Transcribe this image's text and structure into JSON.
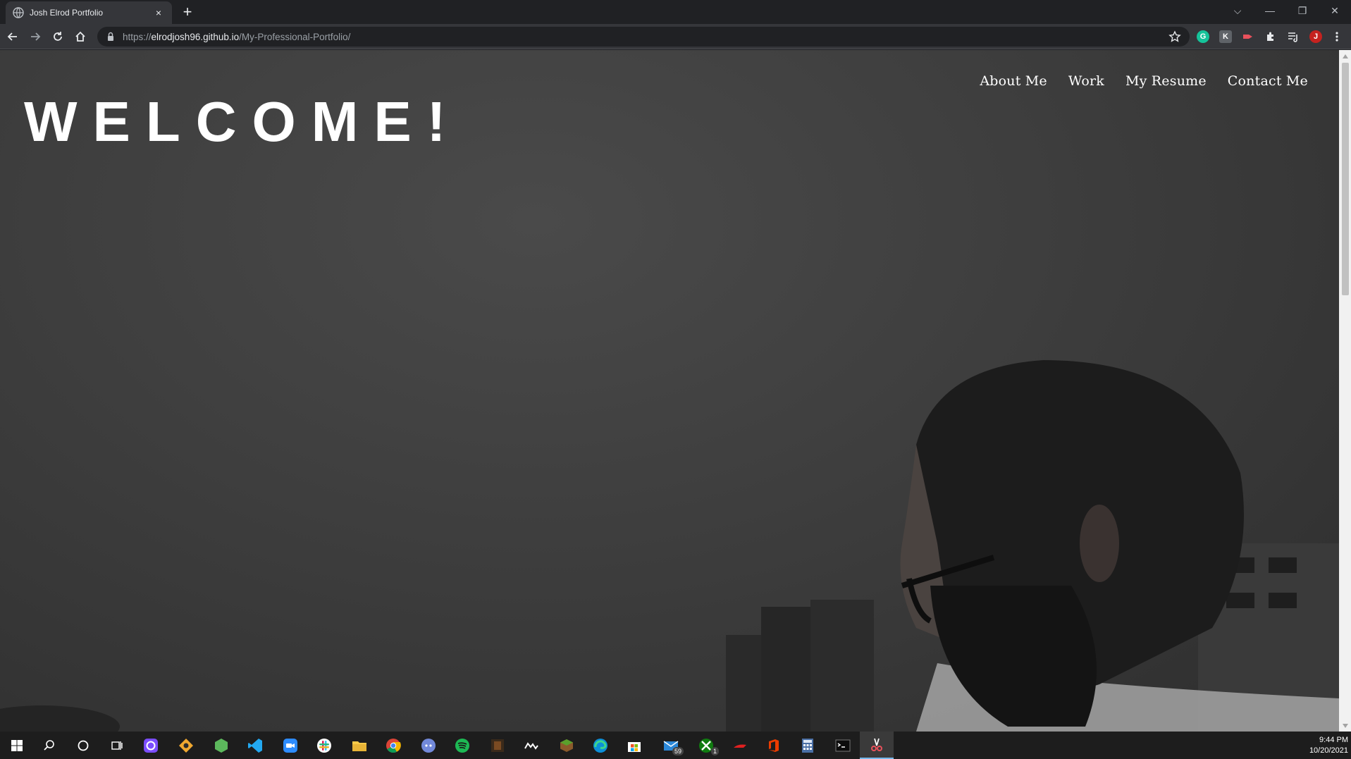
{
  "browser": {
    "tab": {
      "title": "Josh Elrod Portfolio",
      "close_label": "×"
    },
    "new_tab_label": "+",
    "url": {
      "scheme": "https://",
      "host": "elrodjosh96.github.io",
      "path": "/My-Professional-Portfolio/"
    },
    "window_controls": {
      "tab_search": "⌵",
      "minimize": "—",
      "restore": "❐",
      "close": "✕"
    },
    "profile_initial": "J"
  },
  "page": {
    "nav": [
      "About Me",
      "Work",
      "My Resume",
      "Contact Me"
    ],
    "heading": "WELCOME!"
  },
  "taskbar": {
    "mail_badge": "59",
    "xbox_badge": "1",
    "time": "9:44 PM",
    "date": "10/20/2021"
  },
  "colors": {
    "accent_blue": "#76b9ed",
    "chrome_bg": "#35363a",
    "page_overlay": "#3f3f3f"
  }
}
